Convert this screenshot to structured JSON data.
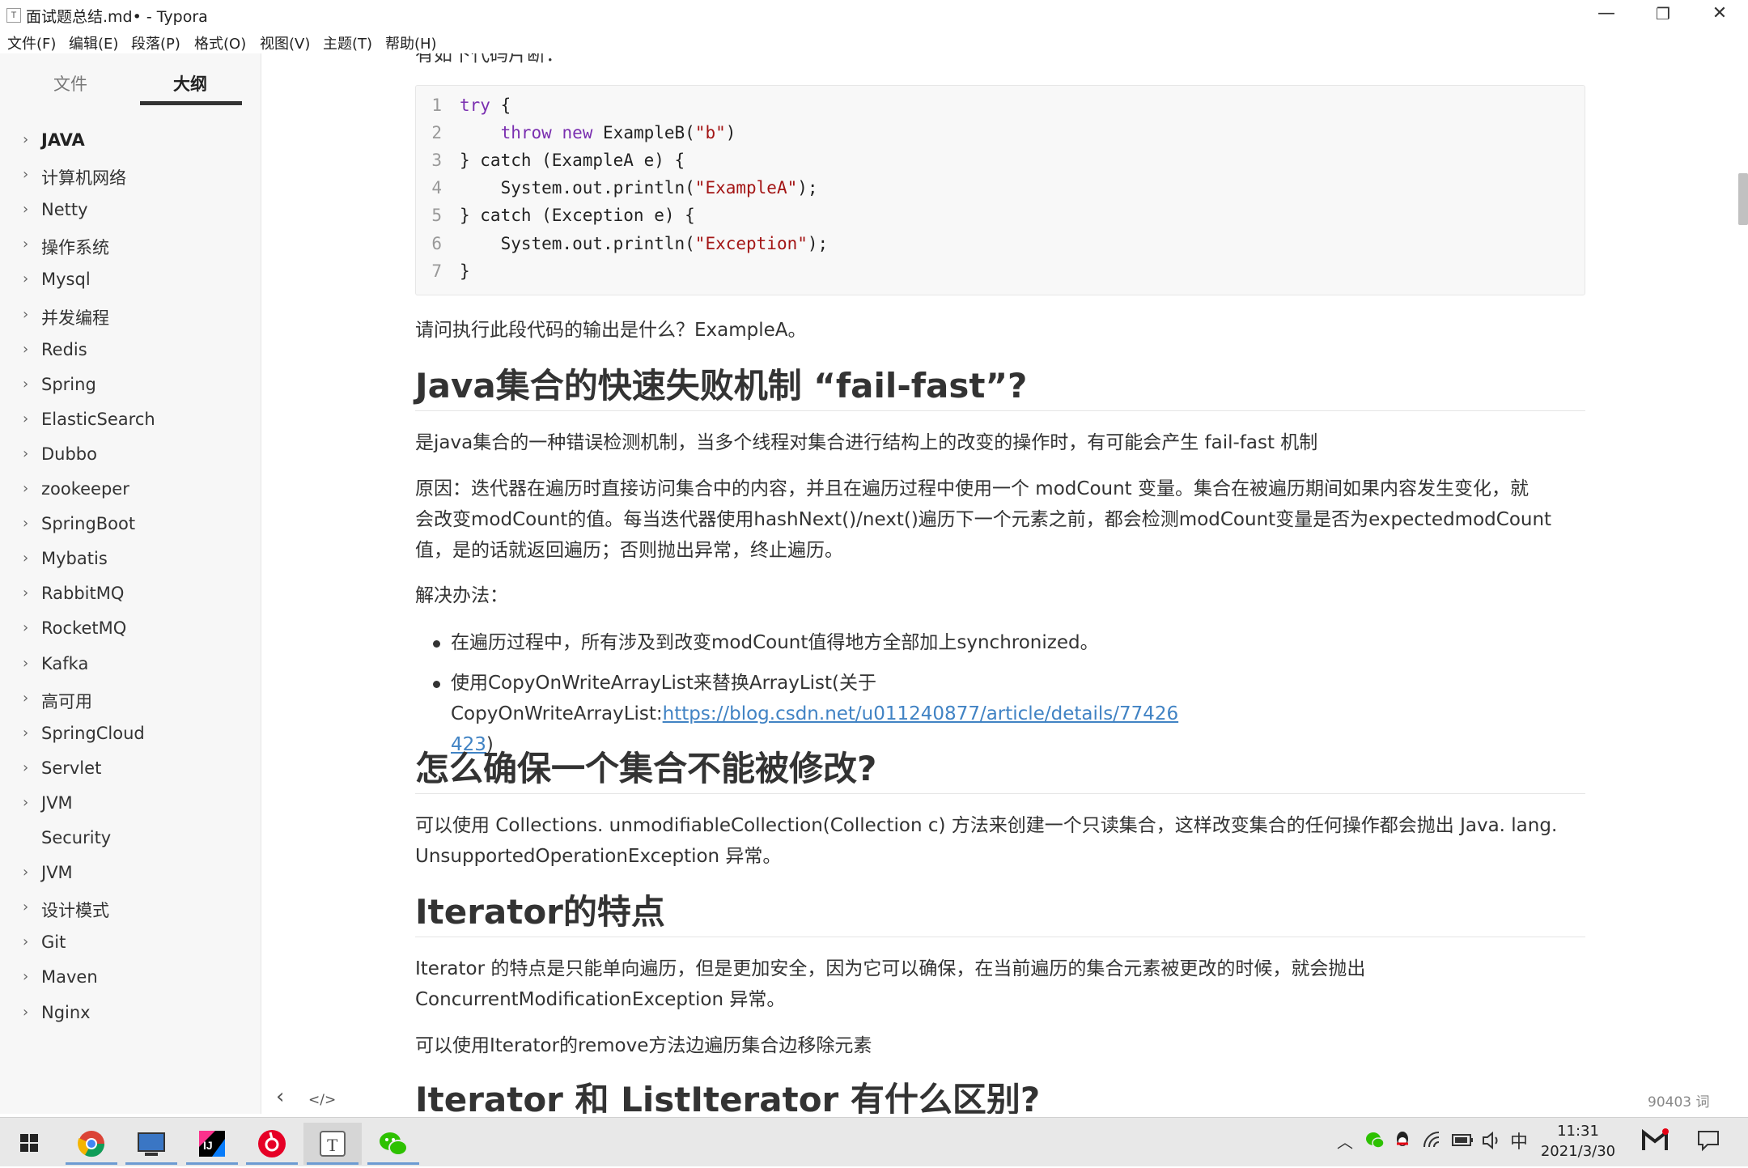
{
  "window": {
    "app_icon": "T",
    "title": "面试题总结.md• - Typora",
    "minimize": "—",
    "restore": "❐",
    "close": "✕"
  },
  "menu": [
    "文件(F)",
    "编辑(E)",
    "段落(P)",
    "格式(O)",
    "视图(V)",
    "主题(T)",
    "帮助(H)"
  ],
  "sidebar": {
    "tabs": [
      "文件",
      "大纲"
    ],
    "outline": [
      {
        "label": "JAVA",
        "chevron": "›",
        "bold": true
      },
      {
        "label": "计算机网络",
        "chevron": "›"
      },
      {
        "label": "Netty",
        "chevron": "›"
      },
      {
        "label": "操作系统",
        "chevron": "›"
      },
      {
        "label": "Mysql",
        "chevron": "›"
      },
      {
        "label": "并发编程",
        "chevron": "›"
      },
      {
        "label": "Redis",
        "chevron": "›"
      },
      {
        "label": "Spring",
        "chevron": "›"
      },
      {
        "label": "ElasticSearch",
        "chevron": "›"
      },
      {
        "label": "Dubbo",
        "chevron": "›"
      },
      {
        "label": "zookeeper",
        "chevron": "›"
      },
      {
        "label": "SpringBoot",
        "chevron": "›"
      },
      {
        "label": "Mybatis",
        "chevron": "›"
      },
      {
        "label": "RabbitMQ",
        "chevron": "›"
      },
      {
        "label": "RocketMQ",
        "chevron": "›"
      },
      {
        "label": "Kafka",
        "chevron": "›"
      },
      {
        "label": "高可用",
        "chevron": "›"
      },
      {
        "label": "SpringCloud",
        "chevron": "›"
      },
      {
        "label": "Servlet",
        "chevron": "›"
      },
      {
        "label": "JVM",
        "chevron": "›"
      },
      {
        "label": "Security",
        "chevron": ""
      },
      {
        "label": "JVM",
        "chevron": "›"
      },
      {
        "label": "设计模式",
        "chevron": "›"
      },
      {
        "label": "Git",
        "chevron": "›"
      },
      {
        "label": "Maven",
        "chevron": "›"
      },
      {
        "label": "Nginx",
        "chevron": "›"
      }
    ]
  },
  "editor": {
    "partial_top_text": "有如下代码片断：",
    "code_lines": [
      {
        "n": "1",
        "segs": [
          {
            "t": "try",
            "c": "kw"
          },
          {
            "t": " {",
            "c": ""
          }
        ]
      },
      {
        "n": "2",
        "segs": [
          {
            "t": "    ",
            "c": ""
          },
          {
            "t": "throw",
            "c": "kw"
          },
          {
            "t": " ",
            "c": ""
          },
          {
            "t": "new",
            "c": "kw"
          },
          {
            "t": " ExampleB(",
            "c": ""
          },
          {
            "t": "\"b\"",
            "c": "str"
          },
          {
            "t": ")",
            "c": ""
          }
        ]
      },
      {
        "n": "3",
        "segs": [
          {
            "t": "} catch (ExampleA e) {",
            "c": ""
          }
        ]
      },
      {
        "n": "4",
        "segs": [
          {
            "t": "    System.out.println(",
            "c": ""
          },
          {
            "t": "\"ExampleA\"",
            "c": "str"
          },
          {
            "t": ");",
            "c": ""
          }
        ]
      },
      {
        "n": "5",
        "segs": [
          {
            "t": "} catch (Exception e) {",
            "c": ""
          }
        ]
      },
      {
        "n": "6",
        "segs": [
          {
            "t": "    System.out.println(",
            "c": ""
          },
          {
            "t": "\"Exception\"",
            "c": "str"
          },
          {
            "t": ");",
            "c": ""
          }
        ]
      },
      {
        "n": "7",
        "segs": [
          {
            "t": "}",
            "c": ""
          }
        ]
      }
    ],
    "answer": "请问执行此段代码的输出是什么？ExampleA。",
    "h_failfast": "Java集合的快速失败机制 “fail-fast”?",
    "p_failfast_1": "是java集合的一种错误检测机制，当多个线程对集合进行结构上的改变的操作时，有可能会产生 fail-fast 机制",
    "p_failfast_2a": "原因：迭代器在遍历时直接访问集合中的内容，并且在遍历过程中使用一个 modCount 变量。集合在被遍历期间如果内容发生变化，就",
    "p_failfast_2b": "会改变modCount的值。每当迭代器使用hashNext()/next()遍历下一个元素之前，都会检测modCount变量是否为expectedmodCount",
    "p_failfast_2c": "值，是的话就返回遍历；否则抛出异常，终止遍历。",
    "p_solution": "解决办法：",
    "bullet_1": "在遍历过程中，所有涉及到改变modCount值得地方全部加上synchronized。",
    "bullet_2_prefix": "使用CopyOnWriteArrayList来替换ArrayList(关于CopyOnWriteArrayList:",
    "bullet_2_link_a": "https://blog.csdn.net/u011240877/article/details/77426",
    "bullet_2_link_b": "423",
    "bullet_2_suffix": ")",
    "h_unmodifiable": "怎么确保一个集合不能被修改?",
    "p_unmodifiable_a": "可以使用 Collections. unmodifiableCollection(Collection c) 方法来创建一个只读集合，这样改变集合的任何操作都会抛出 Java. lang.",
    "p_unmodifiable_b": "UnsupportedOperationException 异常。",
    "h_iterator": "Iterator的特点",
    "p_iterator_a": "Iterator 的特点是只能单向遍历，但是更加安全，因为它可以确保，在当前遍历的集合元素被更改的时候，就会抛出",
    "p_iterator_b": "ConcurrentModificationException 异常。",
    "p_iterator_c": "可以使用Iterator的remove方法边遍历集合边移除元素",
    "h_listiterator": "Iterator 和 ListIterator 有什么区别?",
    "footer_back": "‹",
    "footer_source": "</>",
    "word_count": "90403 词"
  },
  "taskbar": {
    "tray_chevron": "︿",
    "ime": "中",
    "time": "11:31",
    "date": "2021/3/30"
  },
  "colors": {
    "link": "#4183c4",
    "keyword": "#7a2fb0",
    "string": "#a31515",
    "sidebar_bg": "#f7f7f7",
    "code_bg": "#f8f8f8"
  }
}
